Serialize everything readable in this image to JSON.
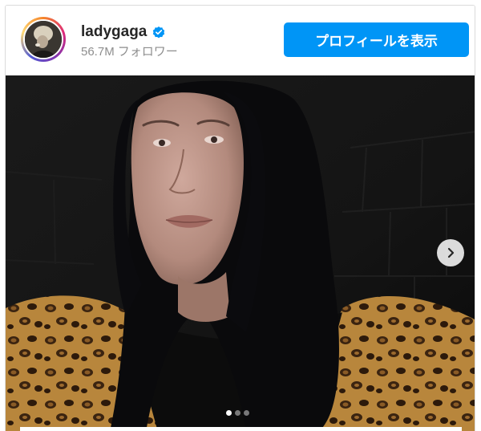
{
  "header": {
    "username": "ladygaga",
    "verified": true,
    "followers_count": "56.7M",
    "followers_label": "フォロワー",
    "profile_button_label": "プロフィールを表示"
  },
  "carousel": {
    "slide_count": 3,
    "active_slide": 1
  },
  "colors": {
    "accent": "#0095f6",
    "username": "#262626",
    "secondary_text": "#8e8e8e",
    "border": "#dbdbdb"
  },
  "icons": {
    "verified": "verified-badge-icon",
    "next": "chevron-right-icon"
  }
}
